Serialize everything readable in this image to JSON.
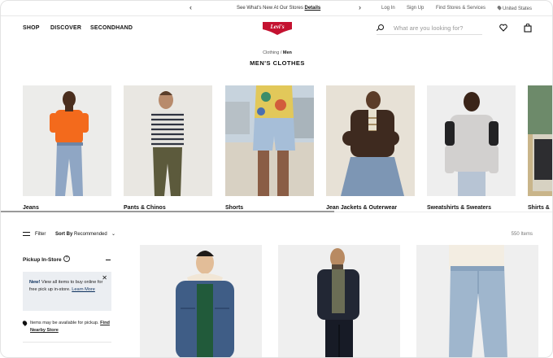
{
  "announcement": {
    "prev_icon": "chevron-left-icon",
    "next_icon": "chevron-right-icon",
    "text": "See What's New At Our Stores",
    "link": "Details"
  },
  "utility": {
    "login": "Log In",
    "signup": "Sign Up",
    "stores": "Find Stores & Services",
    "region": "United States"
  },
  "nav": {
    "items": [
      "SHOP",
      "DISCOVER",
      "SECONDHAND"
    ],
    "logo_text": "Levi's",
    "search_placeholder": "What are you looking for?"
  },
  "breadcrumb": {
    "parent": "Clothing",
    "sep": "/",
    "current": "Men"
  },
  "page_title": "MEN'S CLOTHES",
  "categories": [
    {
      "label": "Jeans"
    },
    {
      "label": "Pants & Chinos"
    },
    {
      "label": "Shorts"
    },
    {
      "label": "Jean Jackets & Outerwear"
    },
    {
      "label": "Sweatshirts & Sweaters"
    },
    {
      "label": "Shirts &"
    }
  ],
  "filters": {
    "filter_label": "Filter",
    "sort_prefix": "Sort By",
    "sort_value": "Recommended",
    "count": "550 Items"
  },
  "sidebar": {
    "pickup_title": "Pickup In-Store",
    "notice_new": "New!",
    "notice_text": "View all items to buy online for free pick up in-store.",
    "notice_link": "Learn More",
    "store_text": "Items may be available for pickup.",
    "store_link": "Find Nearby Store"
  },
  "colors": {
    "brand_red": "#c41230",
    "notice_bg": "#ebeef2",
    "text": "#111111"
  }
}
